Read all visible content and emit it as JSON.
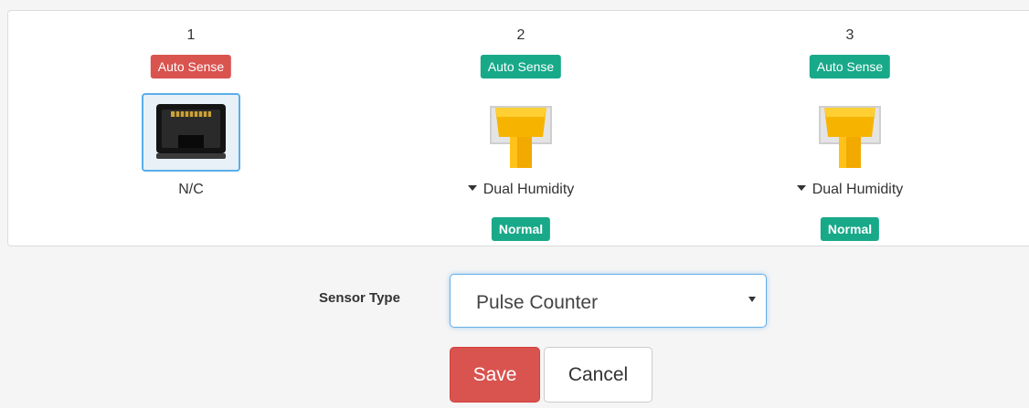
{
  "ports": [
    {
      "number": "1",
      "mode_label": "Auto Sense",
      "mode_color": "#d9534f",
      "connector": "rj45-jack-empty-icon",
      "selected": true,
      "label": "N/C",
      "has_dropdown": false,
      "status": null
    },
    {
      "number": "2",
      "mode_label": "Auto Sense",
      "mode_color": "#18a989",
      "connector": "rj45-plug-connected-icon",
      "selected": false,
      "label": "Dual Humidity",
      "has_dropdown": true,
      "status": "Normal",
      "status_color": "#18a989"
    },
    {
      "number": "3",
      "mode_label": "Auto Sense",
      "mode_color": "#18a989",
      "connector": "rj45-plug-connected-icon",
      "selected": false,
      "label": "Dual Humidity",
      "has_dropdown": true,
      "status": "Normal",
      "status_color": "#18a989"
    }
  ],
  "form": {
    "sensor_type_label": "Sensor Type",
    "sensor_type_value": "Pulse Counter",
    "save_label": "Save",
    "cancel_label": "Cancel"
  },
  "colors": {
    "danger": "#d9534f",
    "success": "#18a989",
    "focus": "#66afe9"
  }
}
